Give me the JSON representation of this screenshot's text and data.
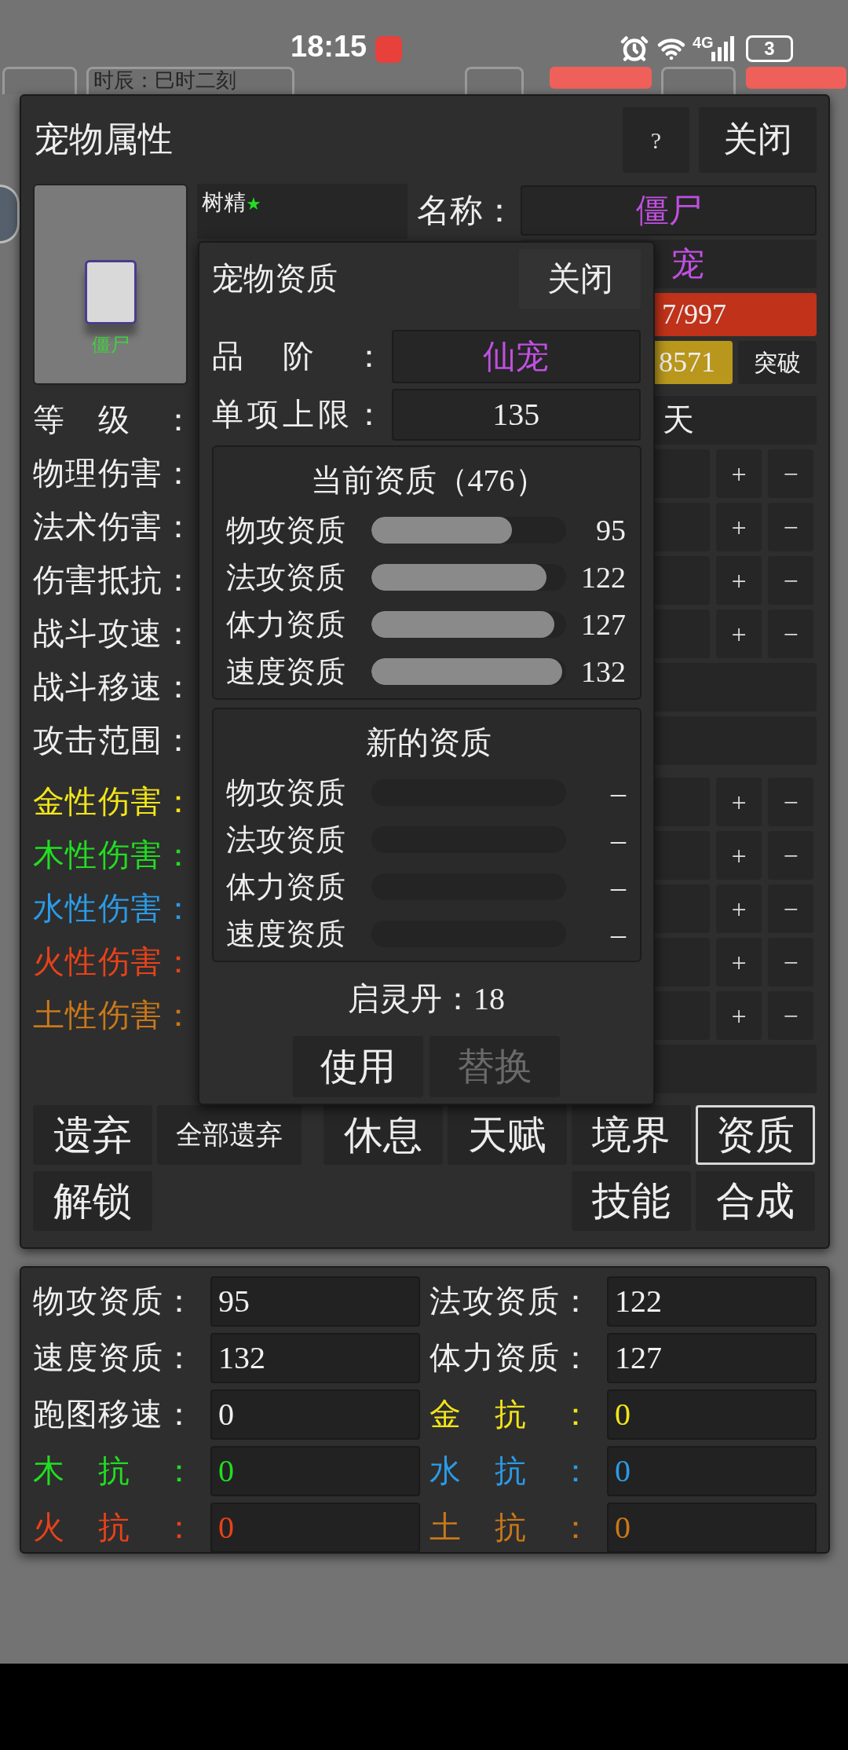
{
  "status_bar": {
    "time": "18:15",
    "network": "4G",
    "battery": "3"
  },
  "background": {
    "clock_text": "时辰：巳时二刻"
  },
  "pet_panel": {
    "title": "宠物属性",
    "help_button": "?",
    "close_button": "关闭",
    "portrait_name": "僵尸",
    "pet_tag": "树精",
    "pet_tag_star": "★",
    "name_label": "名称：",
    "name_value": "僵尸",
    "grade_fragment": "宠",
    "hp_fragment": "7/997",
    "exp_fragment": "8571",
    "breakthrough_button": "突破",
    "stats": [
      {
        "label": "等级：",
        "color": "#f0f0f0",
        "kind": "wide",
        "value": "天"
      },
      {
        "label": "物理伤害：",
        "color": "#f0f0f0",
        "kind": "pm",
        "buttons": [
          "+",
          "−"
        ]
      },
      {
        "label": "法术伤害：",
        "color": "#f0f0f0",
        "kind": "pm",
        "buttons": [
          "+",
          "−"
        ]
      },
      {
        "label": "伤害抵抗：",
        "color": "#f0f0f0",
        "kind": "pm",
        "buttons": [
          "+",
          "−"
        ]
      },
      {
        "label": "战斗攻速：",
        "color": "#f0f0f0",
        "kind": "pm",
        "buttons": [
          "+",
          "−"
        ]
      },
      {
        "label": "战斗移速：",
        "color": "#f0f0f0",
        "kind": "wide"
      },
      {
        "label": "攻击范围：",
        "color": "#f0f0f0",
        "kind": "wide"
      },
      {
        "label": "金性伤害：",
        "color": "#f2e51a",
        "kind": "pm",
        "buttons": [
          "+",
          "−"
        ]
      },
      {
        "label": "木性伤害：",
        "color": "#22dd22",
        "kind": "pm",
        "buttons": [
          "+",
          "−"
        ]
      },
      {
        "label": "水性伤害：",
        "color": "#2b9be8",
        "kind": "pm",
        "buttons": [
          "+",
          "−"
        ]
      },
      {
        "label": "火性伤害：",
        "color": "#e8421a",
        "kind": "pm",
        "buttons": [
          "+",
          "−"
        ]
      },
      {
        "label": "土性伤害：",
        "color": "#c9781a",
        "kind": "pm",
        "buttons": [
          "+",
          "−"
        ]
      },
      {
        "kind": "wide"
      }
    ],
    "action_rows": [
      {
        "left": [
          {
            "label": "遗弃",
            "selected": false
          },
          {
            "label": "全部遗弃",
            "selected": false
          }
        ],
        "right": [
          {
            "label": "休息",
            "selected": false
          },
          {
            "label": "天赋",
            "selected": false
          },
          {
            "label": "境界",
            "selected": false
          },
          {
            "label": "资质",
            "selected": true
          }
        ]
      },
      {
        "left": [
          {
            "label": "解锁",
            "selected": false
          }
        ],
        "right": [
          {
            "label": "技能",
            "selected": false
          },
          {
            "label": "合成",
            "selected": false
          }
        ]
      }
    ]
  },
  "quality_dialog": {
    "title": "宠物资质",
    "close_button": "关闭",
    "grade_label": "品阶：",
    "grade_value": "仙宠",
    "cap_label": "单项上限：",
    "cap_value": "135",
    "current": {
      "title": "当前资质（476）",
      "rows": [
        {
          "label": "物攻资质",
          "level": 0.72,
          "value": "95"
        },
        {
          "label": "法攻资质",
          "level": 0.9,
          "value": "122"
        },
        {
          "label": "体力资质",
          "level": 0.94,
          "value": "127"
        },
        {
          "label": "速度资质",
          "level": 0.98,
          "value": "132"
        }
      ]
    },
    "new": {
      "title": "新的资质",
      "rows": [
        {
          "label": "物攻资质",
          "value": "–"
        },
        {
          "label": "法攻资质",
          "value": "–"
        },
        {
          "label": "体力资质",
          "value": "–"
        },
        {
          "label": "速度资质",
          "value": "–"
        }
      ]
    },
    "pill_text": "启灵丹：18",
    "buttons": [
      {
        "label": "使用",
        "disabled": false
      },
      {
        "label": "替换",
        "disabled": true
      }
    ]
  },
  "aptitude_summary": [
    {
      "label": "物攻资质：",
      "value": "95",
      "color": "#f0f0f0"
    },
    {
      "label": "法攻资质：",
      "value": "122",
      "color": "#f0f0f0"
    },
    {
      "label": "速度资质：",
      "value": "132",
      "color": "#f0f0f0"
    },
    {
      "label": "体力资质：",
      "value": "127",
      "color": "#f0f0f0"
    },
    {
      "label": "跑图移速：",
      "value": "0",
      "color": "#f0f0f0"
    },
    {
      "label": "金抗：",
      "value": "0",
      "color": "#f2e51a"
    },
    {
      "label": "木抗：",
      "value": "0",
      "color": "#22dd22"
    },
    {
      "label": "水抗：",
      "value": "0",
      "color": "#2b9be8"
    },
    {
      "label": "火抗：",
      "value": "0",
      "color": "#e8421a"
    },
    {
      "label": "土抗：",
      "value": "0",
      "color": "#c9781a"
    }
  ]
}
